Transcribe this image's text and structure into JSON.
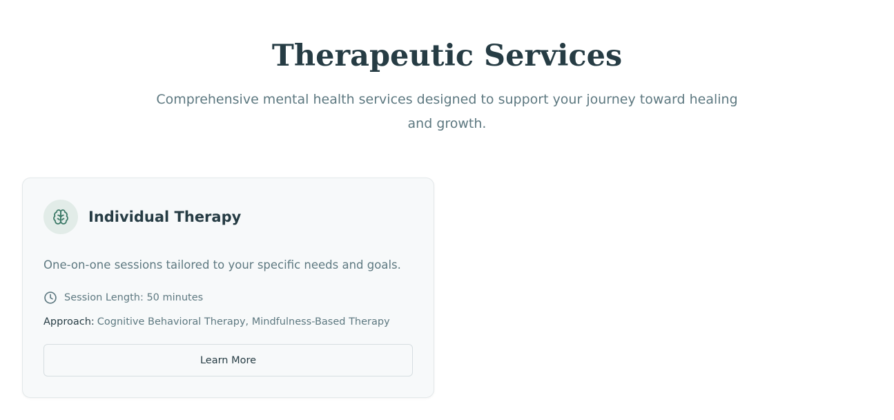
{
  "header": {
    "title": "Therapeutic Services",
    "subtitle": "Comprehensive mental health services designed to support your journey toward healing and growth."
  },
  "services": [
    {
      "icon": "brain-icon",
      "title": "Individual Therapy",
      "description": "One-on-one sessions tailored to your specific needs and goals.",
      "session_icon": "clock-icon",
      "session_length": "Session Length: 50 minutes",
      "approach_label": "Approach:",
      "approach_value": "Cognitive Behavioral Therapy, Mindfulness-Based Therapy",
      "button_label": "Learn More"
    }
  ],
  "colors": {
    "heading": "#263c44",
    "muted_text": "#5d7880",
    "card_background": "#f7f9fa",
    "icon_accent": "#3d7a68",
    "icon_background": "#e2ece8"
  }
}
